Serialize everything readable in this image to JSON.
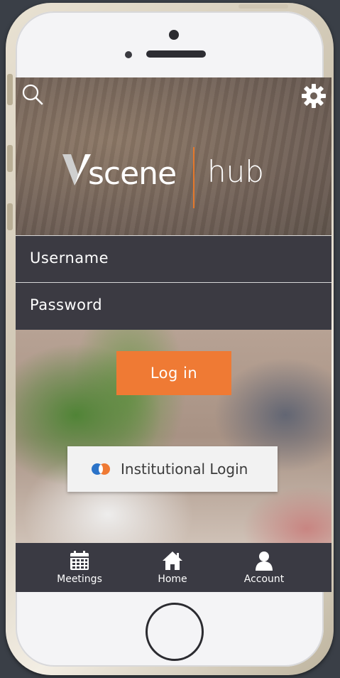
{
  "login": {
    "username_placeholder": "Username",
    "password_placeholder": "Password",
    "login_button": "Log in",
    "institutional_button": "Institutional Login"
  },
  "logo": {
    "wordmark": "scene",
    "hub": "hub"
  },
  "tabs": [
    {
      "label": "Meetings",
      "icon": "calendar-icon"
    },
    {
      "label": "Home",
      "icon": "home-icon"
    },
    {
      "label": "Account",
      "icon": "account-icon"
    }
  ],
  "colors": {
    "accent": "#ef7a34",
    "bar_bg": "#3a3a43"
  }
}
